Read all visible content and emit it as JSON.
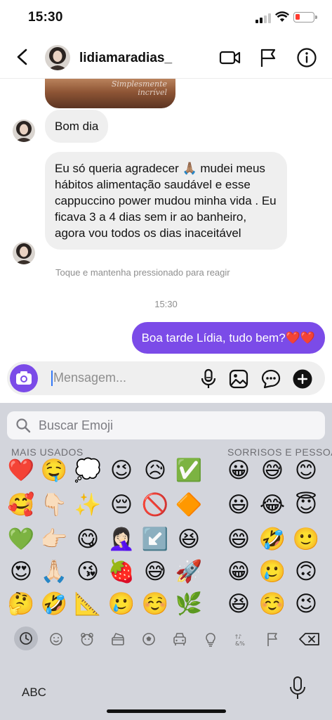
{
  "status_bar": {
    "time": "15:30"
  },
  "header": {
    "username": "lidiamaradias_"
  },
  "chat": {
    "media_watermark_line1": "Simplesmente",
    "media_watermark_line2": "incrível",
    "msg1": "Bom dia",
    "msg2": "Eu só queria agradecer 🙏🏽 mudei meus hábitos alimentação saudável e esse cappuccino power mudou minha vida . Eu ficava 3 a 4 dias sem ir ao banheiro, agora vou todos os dias inaceitável",
    "hint": "Toque e mantenha pressionado para reagir",
    "timestamp": "15:30",
    "reply": "Boa tarde Lídia, tudo bem?❤️❤️"
  },
  "composer": {
    "placeholder": "Mensagem..."
  },
  "keyboard": {
    "search_placeholder": "Buscar Emoji",
    "category_recent": "MAIS USADOS",
    "category_smileys": "SORRISOS E PESSOAS",
    "recent_emojis": [
      [
        "❤️",
        "🤤",
        "💭",
        "😉",
        "😥",
        "✅"
      ],
      [
        "🥰",
        "👇🏻",
        "✨",
        "😔",
        "🚫",
        "🔶"
      ],
      [
        "💚",
        "👉🏻",
        "😋",
        "🤦🏻‍♀️",
        "↙️",
        "😆"
      ],
      [
        "😍",
        "🙏🏻",
        "😘",
        "🍓",
        "😅",
        "🚀"
      ],
      [
        "🤔",
        "🤣",
        "📐",
        "🥲",
        "☺️",
        "🌿"
      ]
    ],
    "smiley_emojis": [
      [
        "😀",
        "😅",
        "😊"
      ],
      [
        "😃",
        "😂",
        "😇"
      ],
      [
        "😄",
        "🤣",
        "🙂"
      ],
      [
        "😁",
        "🥲",
        "🙃"
      ],
      [
        "😆",
        "☺️",
        "😉"
      ]
    ],
    "abc_label": "ABC"
  },
  "colors": {
    "accent": "#7b4be8",
    "keyboard_bg": "#d3d5dc",
    "incoming_bubble": "#efefef"
  }
}
